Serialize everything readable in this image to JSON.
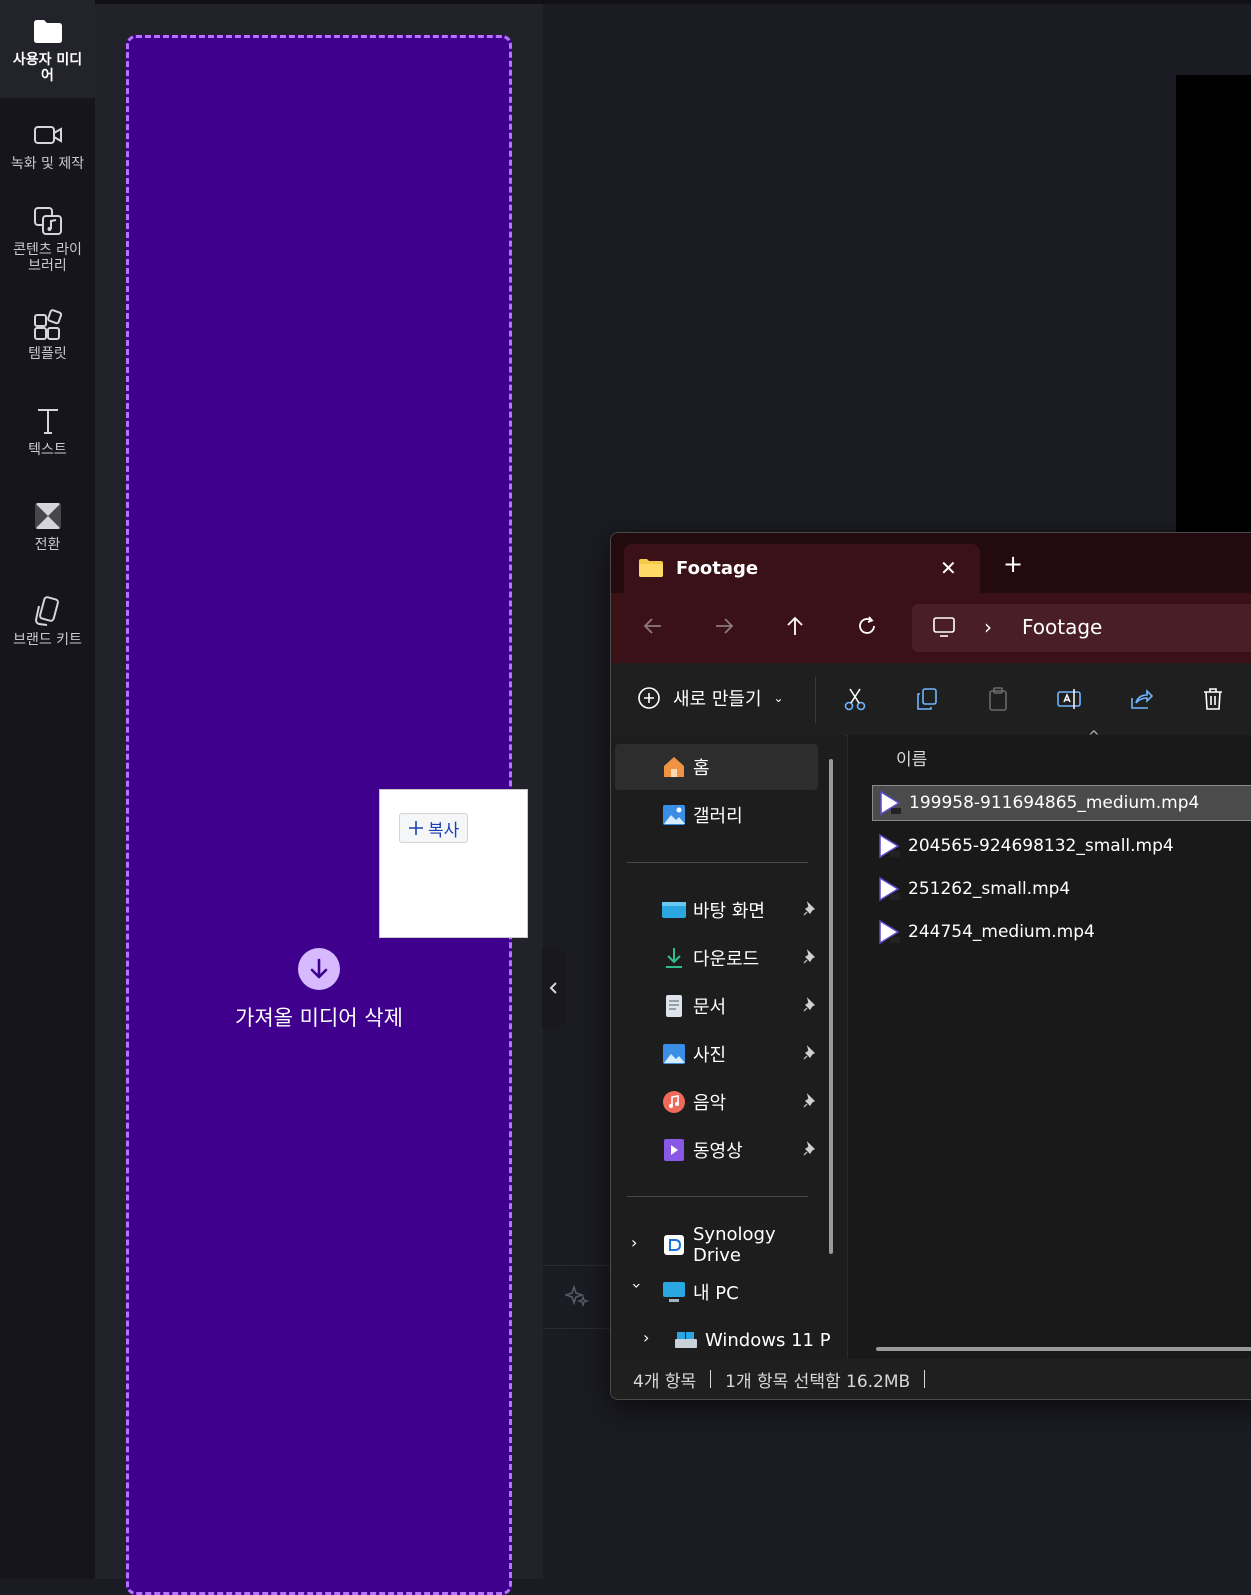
{
  "sidebar": {
    "items": [
      {
        "label": "사용자 미디\n어",
        "icon": "folder-icon",
        "active": true
      },
      {
        "label": "녹화 및 제작",
        "icon": "video-camera-icon"
      },
      {
        "label": "콘텐츠 라이\n브러리",
        "icon": "content-library-icon"
      },
      {
        "label": "템플릿",
        "icon": "templates-icon"
      },
      {
        "label": "텍스트",
        "icon": "text-icon"
      },
      {
        "label": "전환",
        "icon": "transition-icon"
      },
      {
        "label": "브랜드 키트",
        "icon": "brand-kit-icon"
      }
    ]
  },
  "dropzone": {
    "text": "가져올 미디어 삭제",
    "icon": "arrow-down-icon",
    "accent": "#3e008d",
    "border_color": "#b573ff"
  },
  "drag_tooltip": {
    "label": "복사",
    "icon": "plus-icon"
  },
  "explorer": {
    "tab_title": "Footage",
    "address": "Footage",
    "toolbar": {
      "new_label": "새로 만들기"
    },
    "nav": {
      "quick": [
        {
          "label": "홈",
          "icon": "home-icon"
        },
        {
          "label": "갤러리",
          "icon": "gallery-icon"
        }
      ],
      "pinned": [
        {
          "label": "바탕 화면",
          "icon": "desktop-icon"
        },
        {
          "label": "다운로드",
          "icon": "download-icon"
        },
        {
          "label": "문서",
          "icon": "document-icon"
        },
        {
          "label": "사진",
          "icon": "pictures-icon"
        },
        {
          "label": "음악",
          "icon": "music-icon"
        },
        {
          "label": "동영상",
          "icon": "videos-icon"
        }
      ],
      "tree": [
        {
          "label": "Synology Drive",
          "icon": "synology-icon"
        },
        {
          "label": "내 PC",
          "icon": "this-pc-icon"
        },
        {
          "label": "Windows 11 P",
          "icon": "drive-icon"
        }
      ]
    },
    "column_header": "이름",
    "files": [
      {
        "name": "199958-911694865_medium.mp4",
        "selected": true
      },
      {
        "name": "204565-924698132_small.mp4"
      },
      {
        "name": "251262_small.mp4"
      },
      {
        "name": "244754_medium.mp4"
      }
    ],
    "status": {
      "count": "4개 항목",
      "selection": "1개 항목 선택함 16.2MB"
    }
  }
}
